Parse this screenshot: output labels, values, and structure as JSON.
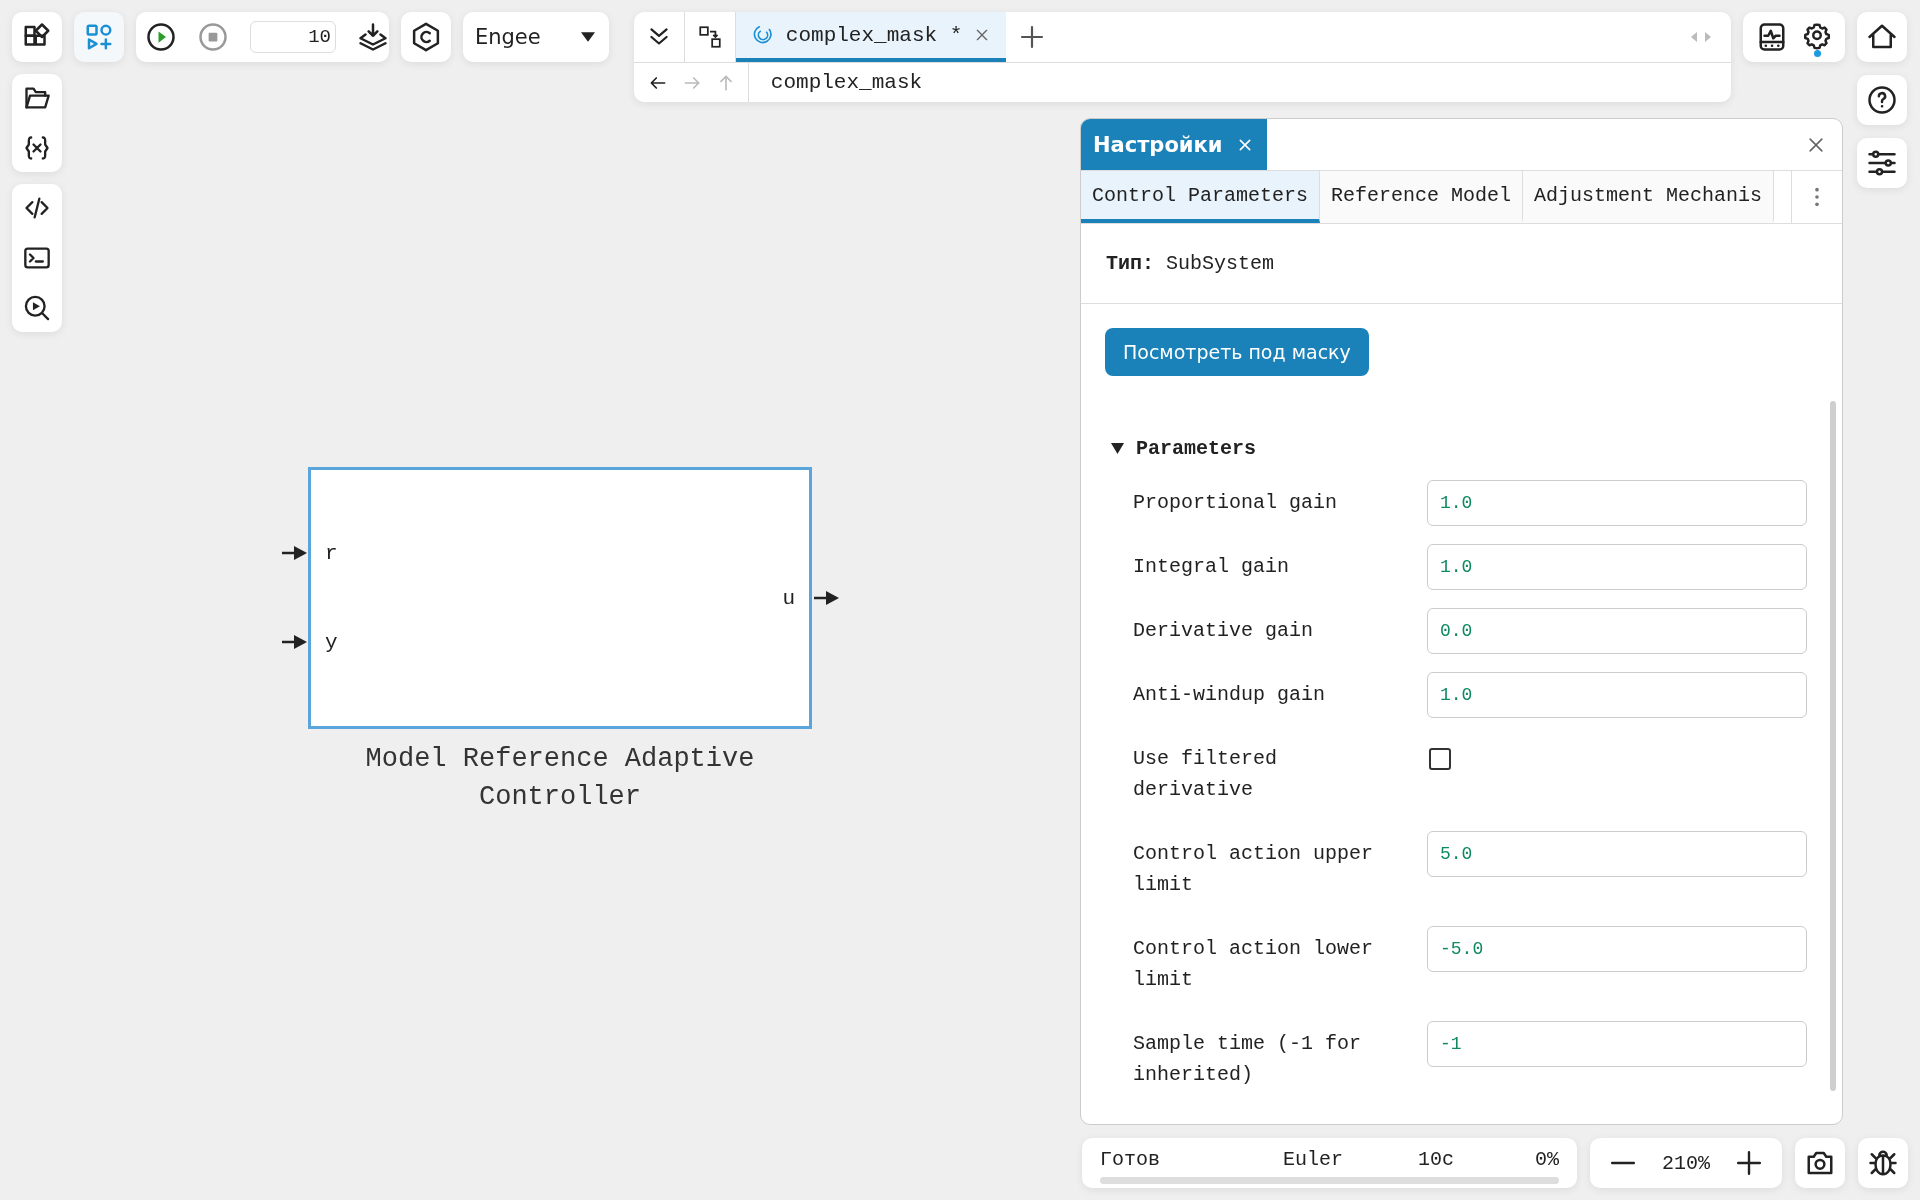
{
  "toolbar": {
    "step_count": "10",
    "engine": "Engee"
  },
  "editor_tabs": [
    {
      "label": "complex_mask *",
      "selected": true
    }
  ],
  "breadcrumb": "complex_mask",
  "canvas": {
    "block": {
      "label": "Model Reference Adaptive Controller",
      "inputs": [
        "r",
        "y"
      ],
      "outputs": [
        "u"
      ]
    }
  },
  "settings_panel": {
    "title": "Настройки",
    "tabs": [
      {
        "label": "Control Parameters",
        "selected": true
      },
      {
        "label": "Reference Model",
        "selected": false
      },
      {
        "label": "Adjustment Mechanis",
        "selected": false
      }
    ],
    "type_label": "Тип:",
    "type_value": "SubSystem",
    "view_button": "Посмотреть под маску",
    "section": {
      "title": "Parameters",
      "expanded": true,
      "fields": [
        {
          "kind": "text",
          "label": "Proportional gain",
          "value": "1.0"
        },
        {
          "kind": "text",
          "label": "Integral gain",
          "value": "1.0"
        },
        {
          "kind": "text",
          "label": "Derivative gain",
          "value": "0.0"
        },
        {
          "kind": "text",
          "label": "Anti-windup gain",
          "value": "1.0"
        },
        {
          "kind": "checkbox",
          "label": "Use filtered derivative",
          "checked": false
        },
        {
          "kind": "text",
          "label": "Control action upper limit",
          "value": "5.0"
        },
        {
          "kind": "text",
          "label": "Control action lower limit",
          "value": "-5.0"
        },
        {
          "kind": "text",
          "label": "Sample time (-1 for inherited)",
          "value": "-1"
        }
      ]
    }
  },
  "status_bar": {
    "state": "Готов",
    "solver": "Euler",
    "time": "10с",
    "progress": "0%",
    "level": 0
  },
  "zoom": "210%"
}
